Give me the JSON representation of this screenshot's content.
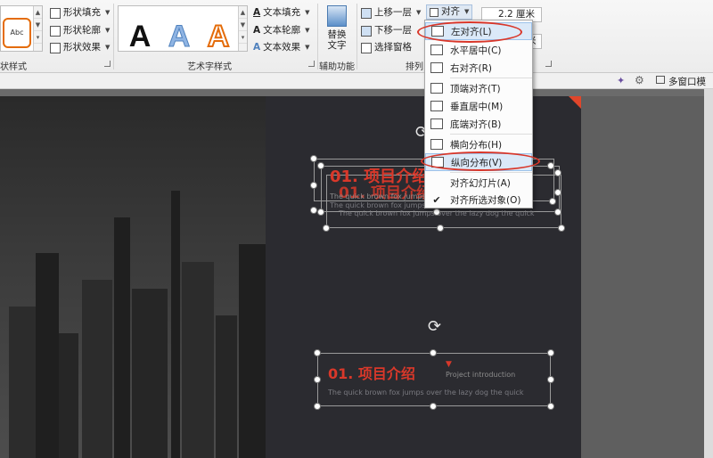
{
  "ribbon": {
    "shape_styles": {
      "group_label": "状样式",
      "gallery_item": "Abc",
      "fill": "形状填充",
      "outline": "形状轮廓",
      "effects": "形状效果"
    },
    "wordart": {
      "group_label": "艺术字样式",
      "letters": [
        "A",
        "A",
        "A"
      ],
      "text_fill": "文本填充",
      "text_outline": "文本轮廓",
      "text_effects": "文本效果"
    },
    "accessibility": {
      "group_label": "辅助功能",
      "replace_label_1": "替换",
      "replace_label_2": "文字"
    },
    "arrange": {
      "group_label": "排列",
      "bring_forward": "上移一层",
      "send_backward": "下移一层",
      "selection_pane": "选择窗格",
      "align": "对齐"
    },
    "size": {
      "height_value": "2.2 厘米",
      "width_value": "米"
    },
    "multi_window": "多窗口模式"
  },
  "align_menu": {
    "items": [
      {
        "label": "左对齐(L)",
        "icon": "align-left-icon"
      },
      {
        "label": "水平居中(C)",
        "icon": "align-center-icon"
      },
      {
        "label": "右对齐(R)",
        "icon": "align-right-icon"
      },
      {
        "label": "顶端对齐(T)",
        "icon": "align-top-icon"
      },
      {
        "label": "垂直居中(M)",
        "icon": "align-middle-icon"
      },
      {
        "label": "底端对齐(B)",
        "icon": "align-bottom-icon"
      },
      {
        "label": "横向分布(H)",
        "icon": "distribute-horizontal-icon"
      },
      {
        "label": "纵向分布(V)",
        "icon": "distribute-vertical-icon"
      },
      {
        "label": "对齐幻灯片(A)",
        "icon": ""
      },
      {
        "label": "对齐所选对象(O)",
        "icon": "check-icon"
      }
    ]
  },
  "slide": {
    "top_group": {
      "title_a": "01. 项目介绍",
      "title_b": "01. 项目介绍",
      "sub_a": "The quick brown fox jumps",
      "body_a": "The quick brown fox jumps",
      "body_b": "The quick brown fox jumps over the lazy dog the quick"
    },
    "bottom_box": {
      "title": "01. 项目介绍",
      "subtitle": "Project introduction",
      "body": "The quick brown fox jumps over the lazy dog the quick"
    }
  },
  "colors": {
    "accent_red": "#d9382a",
    "menu_highlight": "#dbe9f8",
    "slide_bg": "#2b2b30"
  }
}
